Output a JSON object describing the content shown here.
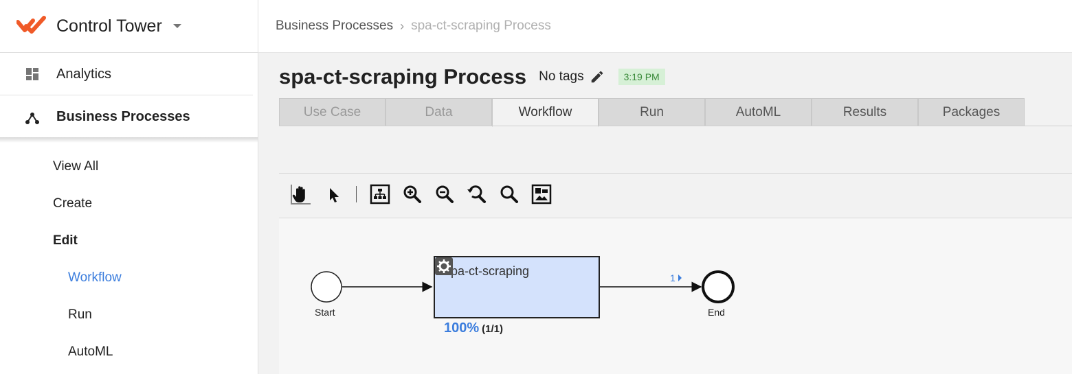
{
  "brand": {
    "title": "Control Tower",
    "logo_color": "#f05a28"
  },
  "sidebar": {
    "items": [
      {
        "label": "Analytics",
        "icon": "dashboard-icon"
      },
      {
        "label": "Business Processes",
        "icon": "hierarchy-icon"
      }
    ],
    "sub_items": [
      "View All",
      "Create",
      "Edit",
      "Workflow",
      "Run",
      "AutoML"
    ]
  },
  "breadcrumb": {
    "parent": "Business Processes",
    "current": "spa-ct-scraping Process"
  },
  "page": {
    "title": "spa-ct-scraping Process",
    "tags": "No tags",
    "time": "3:19 PM"
  },
  "tabs": [
    "Use Case",
    "Data",
    "Workflow",
    "Run",
    "AutoML",
    "Results",
    "Packages"
  ],
  "toolbar": {
    "tools": [
      "hand-icon",
      "pointer-icon",
      "layout-icon",
      "zoom-in-icon",
      "zoom-out-icon",
      "zoom-reset-icon",
      "zoom-fit-icon",
      "minimap-icon"
    ]
  },
  "workflow": {
    "start_label": "Start",
    "end_label": "End",
    "task": {
      "name": "spa-ct-scraping",
      "progress": "100%",
      "count": "(1/1)"
    },
    "edge_label": "1"
  },
  "colors": {
    "accent": "#3b7ddd",
    "task_fill": "#d4e2fc",
    "badge_bg": "#d6f0d6",
    "badge_text": "#3a8a3a"
  }
}
